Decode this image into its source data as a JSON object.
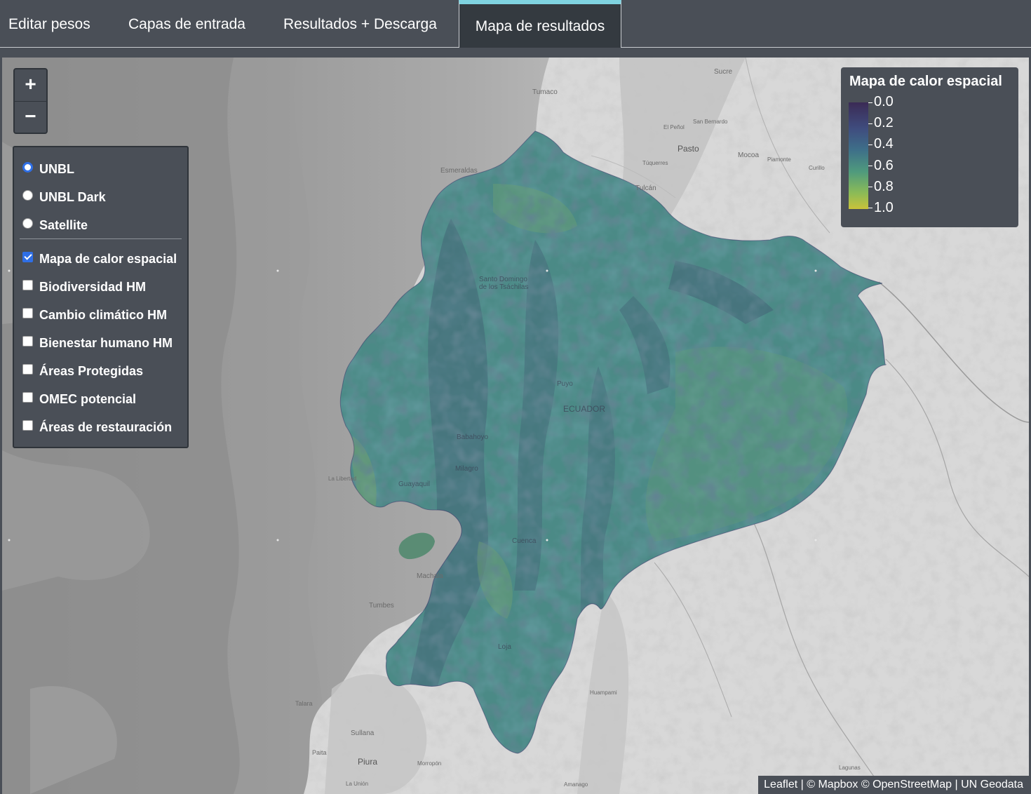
{
  "tabs": [
    {
      "label": "Editar pesos"
    },
    {
      "label": "Capas de entrada"
    },
    {
      "label": "Resultados + Descarga"
    },
    {
      "label": "Mapa de resultados",
      "active": true
    }
  ],
  "zoom": {
    "in": "+",
    "out": "−"
  },
  "layer_control": {
    "basemaps": [
      {
        "label": "UNBL",
        "selected": true
      },
      {
        "label": "UNBL Dark",
        "selected": false
      },
      {
        "label": "Satellite",
        "selected": false
      }
    ],
    "overlays": [
      {
        "label": "Mapa de calor espacial",
        "checked": true
      },
      {
        "label": "Biodiversidad HM",
        "checked": false
      },
      {
        "label": "Cambio climático HM",
        "checked": false
      },
      {
        "label": "Bienestar humano HM",
        "checked": false
      },
      {
        "label": "Áreas Protegidas",
        "checked": false
      },
      {
        "label": "OMEC potencial",
        "checked": false
      },
      {
        "label": "Áreas de restauración",
        "checked": false
      }
    ]
  },
  "legend": {
    "title": "Mapa de calor espacial",
    "labels": [
      "0.0",
      "0.2",
      "0.4",
      "0.6",
      "0.8",
      "1.0"
    ],
    "colors": [
      "#3b2b55",
      "#3f4d7f",
      "#3e7089",
      "#4f9a7d",
      "#8bbb57",
      "#c9c23a"
    ]
  },
  "map_labels": {
    "tumaco": "Tumaco",
    "esmeraldas": "Esmeraldas",
    "pasto": "Pasto",
    "tulcan": "Tulcán",
    "sucre": "Sucre",
    "mocoa": "Mocoa",
    "el_penol": "El Peñol",
    "san_bernardo": "San Bernardo",
    "tuquerres": "Túquerres",
    "piamonte": "Piamonte",
    "curillo": "Curillo",
    "santo_domingo": "Santo Domingo de los Tsáchilas",
    "ecuador": "ECUADOR",
    "babahoyo": "Babahoyo",
    "milagro": "Milagro",
    "guayaquil": "Guayaquil",
    "la_libertad": "La Libertad",
    "machala": "Machala",
    "tumbes": "Tumbes",
    "talara": "Talara",
    "sullana": "Sullana",
    "paita": "Paita",
    "piura": "Piura",
    "morropon": "Morropón",
    "la_union": "La Unión",
    "huampami": "Huampami",
    "lagunas": "Lagunas",
    "amanago": "Amanago",
    "cuenca": "Cuenca",
    "loja": "Loja",
    "puyo": "Puyo"
  },
  "attribution": "Leaflet | © Mapbox © OpenStreetMap | UN Geodata"
}
